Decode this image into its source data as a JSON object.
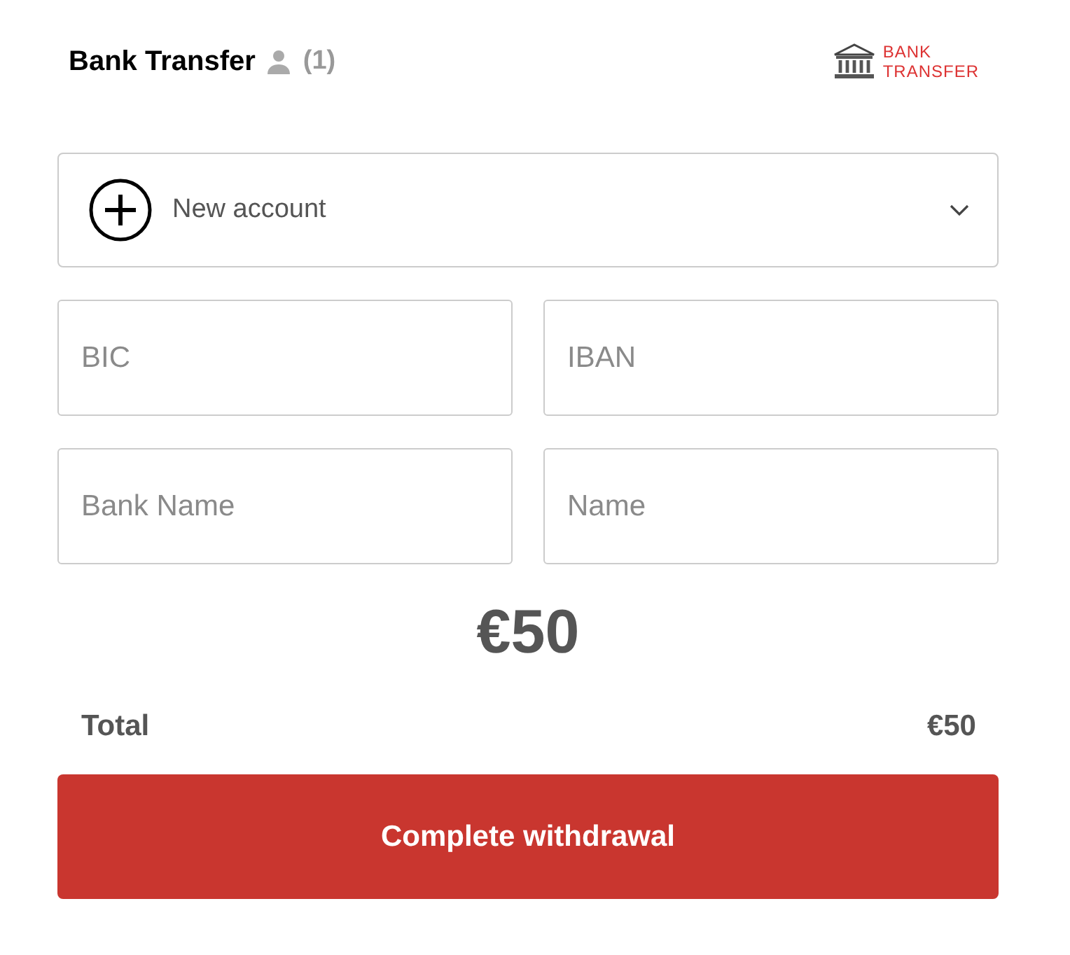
{
  "header": {
    "title": "Bank Transfer",
    "count": "(1)",
    "logo": {
      "line_1": "BANK",
      "line_2": "TRANSFER"
    }
  },
  "account_select": {
    "value": "New account"
  },
  "fields": [
    {
      "placeholder": "BIC"
    },
    {
      "placeholder": "IBAN"
    },
    {
      "placeholder": "Bank Name"
    },
    {
      "placeholder": "Name"
    }
  ],
  "amount": "€50",
  "total": {
    "label": "Total",
    "value": "€50"
  },
  "submit_button": "Complete withdrawal"
}
